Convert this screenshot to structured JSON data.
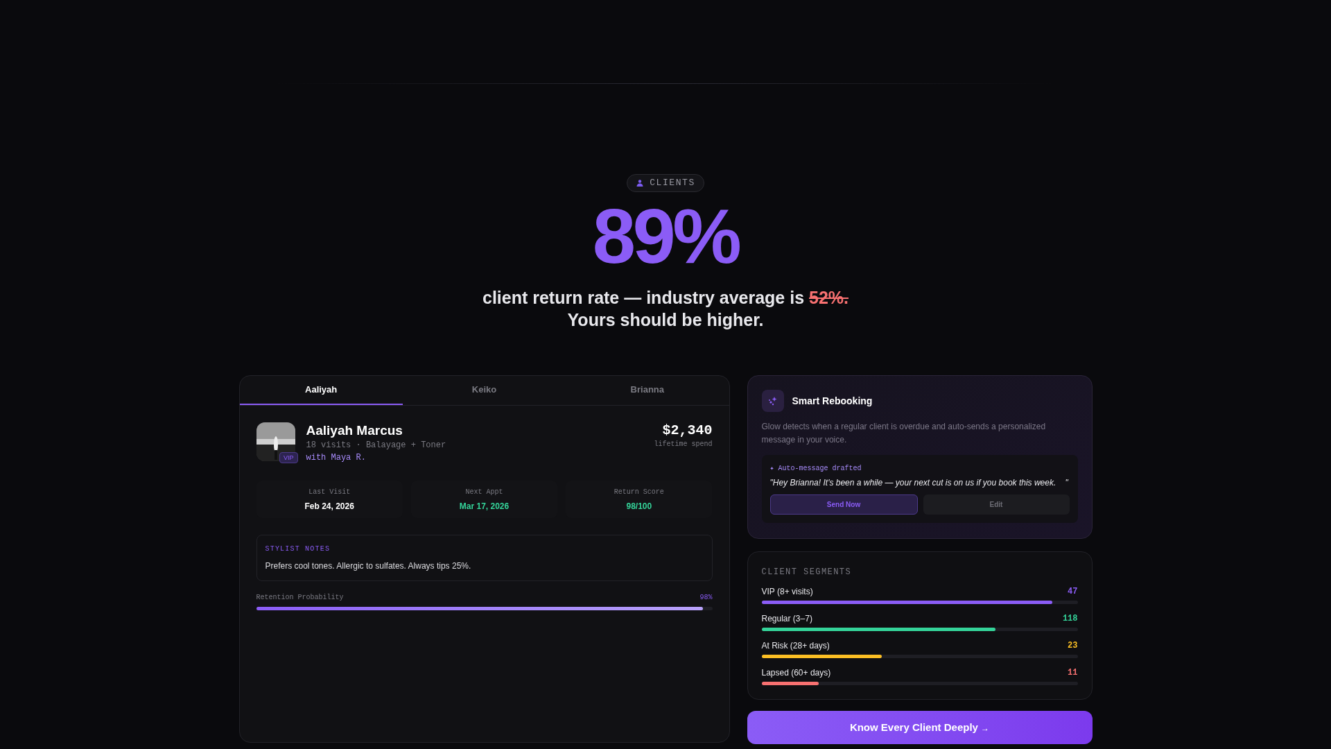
{
  "badge": {
    "label": "CLIENTS"
  },
  "headline": {
    "stat": "89%",
    "line_1": "client return rate — industry average is",
    "struck": "52%.",
    "line_2": "Yours should be higher."
  },
  "client_card": {
    "tabs": [
      {
        "label": "Aaliyah",
        "selected": true
      },
      {
        "label": "Keiko",
        "selected": false
      },
      {
        "label": "Brianna",
        "selected": false
      }
    ],
    "client": {
      "name": "Aaliyah Marcus",
      "details": "18 visits · Balayage + Toner",
      "stylist": "with Maya R.",
      "badge": "VIP",
      "spend": "$2,340",
      "spend_label": "lifetime spend"
    },
    "stats": [
      {
        "label": "Last Visit",
        "value": "Feb 24, 2026",
        "color": "#ffffff"
      },
      {
        "label": "Next Appt",
        "value": "Mar 17, 2026",
        "color": "#34d399"
      },
      {
        "label": "Return Score",
        "value": "98/100",
        "color": "#34d399"
      }
    ],
    "notes": {
      "title": "STYLIST NOTES",
      "text": "Prefers cool tones. Allergic to sulfates. Always tips 25%."
    },
    "retention": {
      "label": "Retention Probability",
      "reading": "98%",
      "level": 0.98
    }
  },
  "rebooking": {
    "title": "Smart Rebooking",
    "description": "Glow detects when a regular client is overdue and auto-sends a personalized message in your voice.",
    "draft_label": "✦ Auto-message drafted",
    "message": "\"Hey Brianna! It's been a while — your next cut is on us if you book this week.    \"",
    "buttons": [
      "Send Now",
      "Edit"
    ]
  },
  "segments": {
    "title": "CLIENT SEGMENTS",
    "items": [
      {
        "label": "VIP (8+ visits)",
        "count": "47",
        "level": 0.92,
        "color": "#8b5cf6"
      },
      {
        "label": "Regular (3–7)",
        "count": "118",
        "level": 0.74,
        "color": "#34d399"
      },
      {
        "label": "At Risk (28+ days)",
        "count": "23",
        "level": 0.38,
        "color": "#fbbf24"
      },
      {
        "label": "Lapsed (60+ days)",
        "count": "11",
        "level": 0.18,
        "color": "#f87171"
      }
    ]
  },
  "cta": {
    "label": "Know Every Client Deeply",
    "arrow": "→"
  }
}
